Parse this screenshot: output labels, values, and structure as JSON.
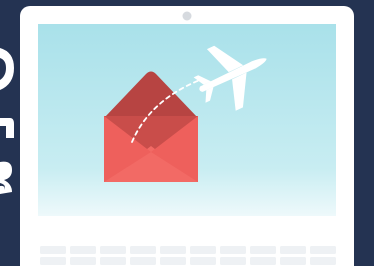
{
  "illustration": {
    "subject": "laptop-with-email-envelope-and-paper-plane",
    "colors": {
      "background": "#243352",
      "laptop_body": "#ffffff",
      "screen": "#aee4ec",
      "envelope": "#e85a57",
      "envelope_dark": "#b74442",
      "plane": "#ffffff",
      "keys": "#eef1f4"
    }
  }
}
